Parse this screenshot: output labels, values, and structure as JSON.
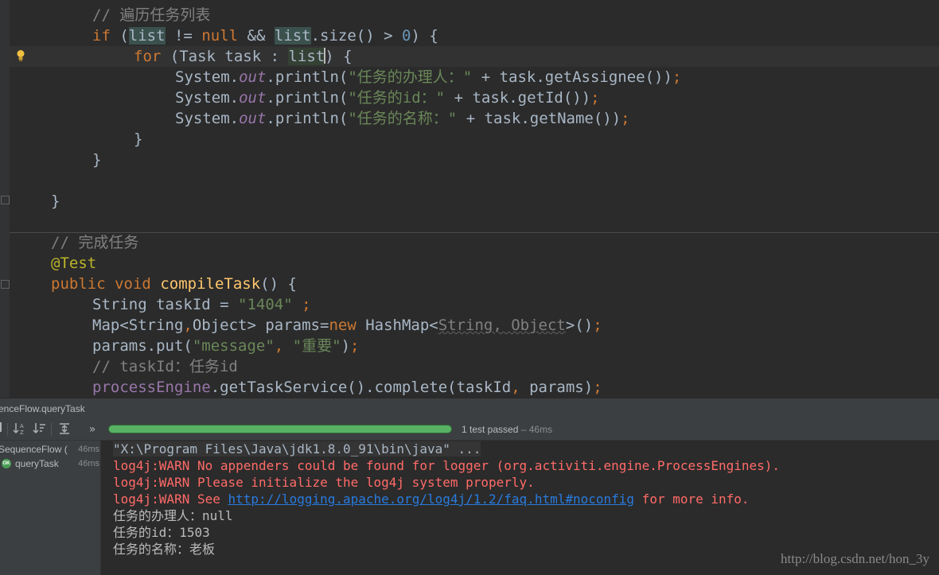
{
  "editor": {
    "lines": [
      {
        "indent": "    ",
        "parts": [
          {
            "t": "// 遍历任务列表",
            "c": "c"
          }
        ]
      },
      {
        "indent": "    ",
        "parts": [
          {
            "t": "if",
            "c": "k"
          },
          {
            "t": " (",
            "c": "w"
          },
          {
            "t": "list",
            "c": "w hl2"
          },
          {
            "t": " != ",
            "c": "w"
          },
          {
            "t": "null",
            "c": "k"
          },
          {
            "t": " && ",
            "c": "w"
          },
          {
            "t": "list",
            "c": "w hl2"
          },
          {
            "t": ".size() > ",
            "c": "w"
          },
          {
            "t": "0",
            "c": "num"
          },
          {
            "t": ") {",
            "c": "w"
          }
        ]
      },
      {
        "indent": "        ",
        "parts": [
          {
            "t": "for",
            "c": "k"
          },
          {
            "t": " (Task task : ",
            "c": "w"
          },
          {
            "t": "list",
            "c": "w hl"
          },
          {
            "t": "CARET",
            "c": "caret"
          },
          {
            "t": ") {",
            "c": "w"
          }
        ]
      },
      {
        "indent": "            ",
        "parts": [
          {
            "t": "System.",
            "c": "w"
          },
          {
            "t": "out",
            "c": "f"
          },
          {
            "t": ".println(",
            "c": "w"
          },
          {
            "t": "\"任务的办理人：\"",
            "c": "s"
          },
          {
            "t": " + task.getAssignee())",
            "c": "w"
          },
          {
            "t": ";",
            "c": "k"
          }
        ]
      },
      {
        "indent": "            ",
        "parts": [
          {
            "t": "System.",
            "c": "w"
          },
          {
            "t": "out",
            "c": "f"
          },
          {
            "t": ".println(",
            "c": "w"
          },
          {
            "t": "\"任务的id：\"",
            "c": "s"
          },
          {
            "t": " + task.getId())",
            "c": "w"
          },
          {
            "t": ";",
            "c": "k"
          }
        ]
      },
      {
        "indent": "            ",
        "parts": [
          {
            "t": "System.",
            "c": "w"
          },
          {
            "t": "out",
            "c": "f"
          },
          {
            "t": ".println(",
            "c": "w"
          },
          {
            "t": "\"任务的名称：\"",
            "c": "s"
          },
          {
            "t": " + task.getName())",
            "c": "w"
          },
          {
            "t": ";",
            "c": "k"
          }
        ]
      },
      {
        "indent": "        ",
        "parts": [
          {
            "t": "}",
            "c": "w"
          }
        ]
      },
      {
        "indent": "    ",
        "parts": [
          {
            "t": "}",
            "c": "w"
          }
        ]
      },
      {
        "indent": "",
        "parts": []
      },
      {
        "indent": "",
        "parts": [
          {
            "t": "}",
            "c": "w"
          }
        ]
      },
      {
        "indent": "",
        "parts": []
      },
      {
        "indent": "",
        "parts": [
          {
            "t": "// 完成任务",
            "c": "c"
          }
        ]
      },
      {
        "indent": "",
        "parts": [
          {
            "t": "@Test",
            "c": "an"
          }
        ]
      },
      {
        "indent": "",
        "parts": [
          {
            "t": "public",
            "c": "k"
          },
          {
            "t": " ",
            "c": "w"
          },
          {
            "t": "void",
            "c": "k"
          },
          {
            "t": " ",
            "c": "w"
          },
          {
            "t": "compileTask",
            "c": "fn"
          },
          {
            "t": "() {",
            "c": "w"
          }
        ]
      },
      {
        "indent": "    ",
        "parts": [
          {
            "t": "String taskId = ",
            "c": "w"
          },
          {
            "t": "\"1404\"",
            "c": "s"
          },
          {
            "t": " ;",
            "c": "k"
          }
        ]
      },
      {
        "indent": "    ",
        "parts": [
          {
            "t": "Map<String",
            "c": "w"
          },
          {
            "t": ",",
            "c": "k"
          },
          {
            "t": "Object> params=",
            "c": "w"
          },
          {
            "t": "new",
            "c": "k"
          },
          {
            "t": " HashMap<",
            "c": "w"
          },
          {
            "t": "String, Object",
            "c": "ul"
          },
          {
            "t": ">()",
            "c": "w"
          },
          {
            "t": ";",
            "c": "k"
          }
        ]
      },
      {
        "indent": "    ",
        "parts": [
          {
            "t": "params.put(",
            "c": "w"
          },
          {
            "t": "\"message\"",
            "c": "s"
          },
          {
            "t": ", ",
            "c": "k"
          },
          {
            "t": "\"重要\"",
            "c": "s"
          },
          {
            "t": ")",
            "c": "w"
          },
          {
            "t": ";",
            "c": "k"
          }
        ]
      },
      {
        "indent": "    ",
        "parts": [
          {
            "t": "// taskId：任务id",
            "c": "c"
          }
        ]
      },
      {
        "indent": "    ",
        "parts": [
          {
            "t": "processEngine",
            "c": "pe"
          },
          {
            "t": ".getTaskService().complete(taskId",
            "c": "w"
          },
          {
            "t": ", ",
            "c": "k"
          },
          {
            "t": "params)",
            "c": "w"
          },
          {
            "t": ";",
            "c": "k"
          }
        ]
      }
    ]
  },
  "run": {
    "header_title": "enceFlow.queryTask",
    "status_main": "1 test passed",
    "status_time": " – 46ms",
    "progress_fraction": 1.0,
    "toolbar_icons": [
      "stop-icon",
      "sort-alpha-icon",
      "sort-duration-icon",
      "expand-all-icon",
      "more-icon"
    ],
    "tree": [
      {
        "label": "SequenceFlow (",
        "time": "46ms",
        "selected": true
      },
      {
        "label": "queryTask",
        "time": "46ms",
        "selected": false
      }
    ],
    "console": [
      {
        "text": "\"X:\\Program Files\\Java\\jdk1.8.0_91\\bin\\java\" ...",
        "kind": "cmd"
      },
      {
        "text": "log4j:WARN No appenders could be found for logger (org.activiti.engine.ProcessEngines).",
        "kind": "err"
      },
      {
        "text": "log4j:WARN Please initialize the log4j system properly.",
        "kind": "err"
      },
      {
        "pre": "log4j:WARN See ",
        "link": "http://logging.apache.org/log4j/1.2/faq.html#noconfig",
        "post": " for more info.",
        "kind": "errlink"
      },
      {
        "text": "任务的办理人：null",
        "kind": "out"
      },
      {
        "text": "任务的id：1503",
        "kind": "out"
      },
      {
        "text": "任务的名称：老板",
        "kind": "out"
      }
    ],
    "watermark": "http://blog.csdn.net/hon_3y"
  },
  "colors": {
    "pass_green": "#499c54",
    "error_red": "#ff6b68",
    "link_blue": "#287bde"
  }
}
